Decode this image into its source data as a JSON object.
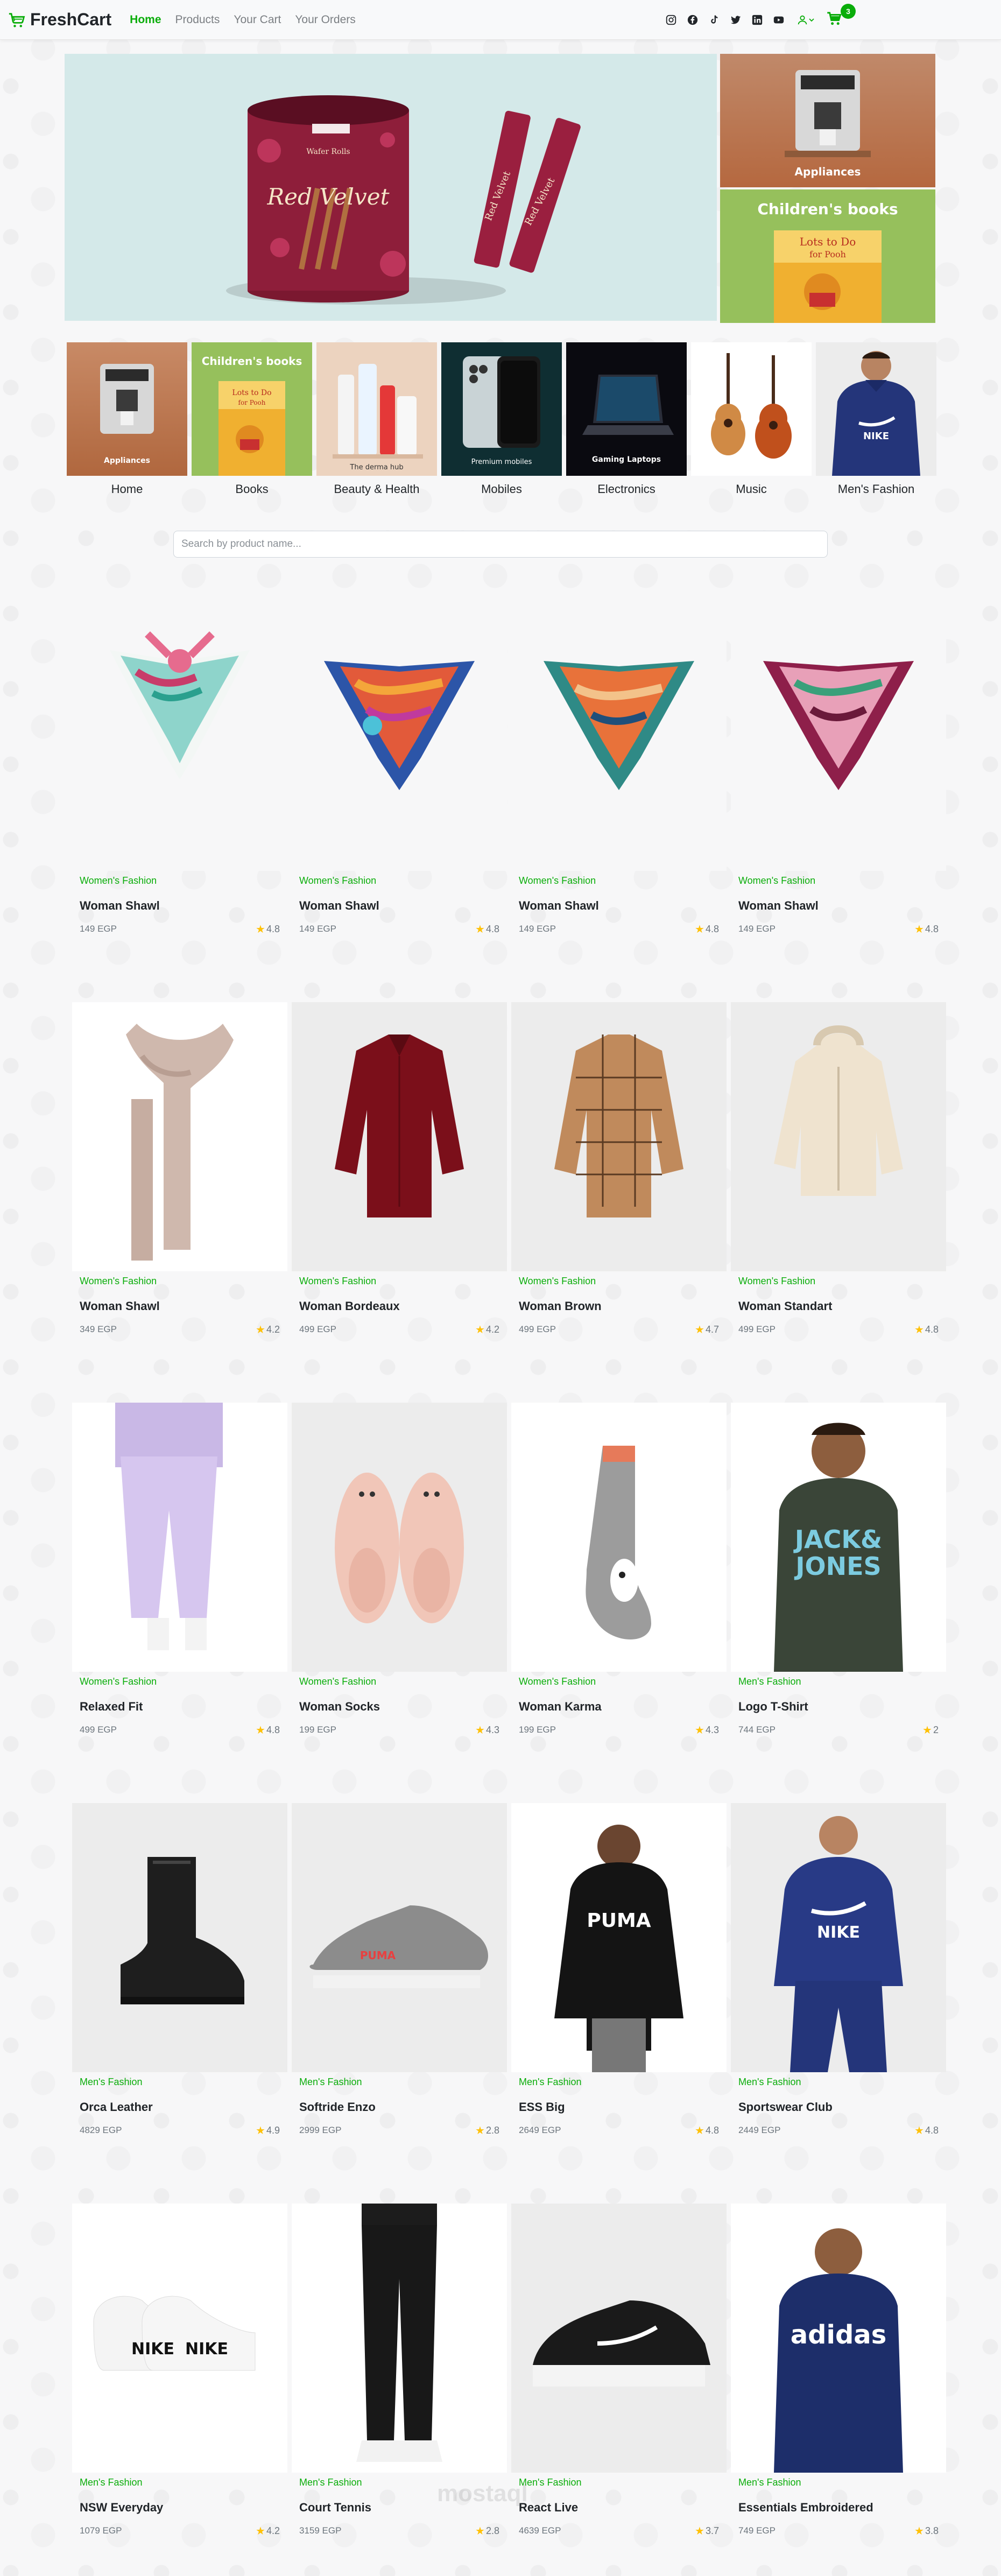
{
  "nav": {
    "brand": "FreshCart",
    "links": [
      "Home",
      "Products",
      "Your Cart",
      "Your Orders"
    ],
    "social_icons": [
      "instagram-icon",
      "facebook-icon",
      "tiktok-icon",
      "twitter-icon",
      "linkedin-icon",
      "youtube-icon"
    ],
    "cart_count": "3"
  },
  "hero": {
    "main_product": "Red Velvet",
    "main_sub": "Wafer Rolls",
    "side_top_label": "Appliances",
    "side_bottom_label": "Children's books"
  },
  "categories": [
    {
      "label": "Home",
      "caption": "Appliances"
    },
    {
      "label": "Books",
      "caption": "Children's books"
    },
    {
      "label": "Beauty & Health",
      "caption": "The derma hub"
    },
    {
      "label": "Mobiles",
      "caption": "Premium mobiles"
    },
    {
      "label": "Electronics",
      "caption": "Gaming Laptops"
    },
    {
      "label": "Music",
      "caption": ""
    },
    {
      "label": "Men's Fashion",
      "caption": ""
    }
  ],
  "search": {
    "placeholder": "Search by product name..."
  },
  "products": [
    {
      "category": "Women's Fashion",
      "title": "Woman Shawl",
      "price": "149 EGP",
      "rating": "4.8"
    },
    {
      "category": "Women's Fashion",
      "title": "Woman Shawl",
      "price": "149 EGP",
      "rating": "4.8"
    },
    {
      "category": "Women's Fashion",
      "title": "Woman Shawl",
      "price": "149 EGP",
      "rating": "4.8"
    },
    {
      "category": "Women's Fashion",
      "title": "Woman Shawl",
      "price": "149 EGP",
      "rating": "4.8"
    },
    {
      "category": "Women's Fashion",
      "title": "Woman Shawl",
      "price": "349 EGP",
      "rating": "4.2"
    },
    {
      "category": "Women's Fashion",
      "title": "Woman Bordeaux",
      "price": "499 EGP",
      "rating": "4.2"
    },
    {
      "category": "Women's Fashion",
      "title": "Woman Brown",
      "price": "499 EGP",
      "rating": "4.7"
    },
    {
      "category": "Women's Fashion",
      "title": "Woman Standart",
      "price": "499 EGP",
      "rating": "4.8"
    },
    {
      "category": "Women's Fashion",
      "title": "Relaxed Fit",
      "price": "499 EGP",
      "rating": "4.8"
    },
    {
      "category": "Women's Fashion",
      "title": "Woman Socks",
      "price": "199 EGP",
      "rating": "4.3"
    },
    {
      "category": "Women's Fashion",
      "title": "Woman Karma",
      "price": "199 EGP",
      "rating": "4.3"
    },
    {
      "category": "Men's Fashion",
      "title": "Logo T-Shirt",
      "price": "744 EGP",
      "rating": "2"
    },
    {
      "category": "Men's Fashion",
      "title": "Orca Leather",
      "price": "4829 EGP",
      "rating": "4.9"
    },
    {
      "category": "Men's Fashion",
      "title": "Softride Enzo",
      "price": "2999 EGP",
      "rating": "2.8"
    },
    {
      "category": "Men's Fashion",
      "title": "ESS Big",
      "price": "2649 EGP",
      "rating": "4.8"
    },
    {
      "category": "Men's Fashion",
      "title": "Sportswear Club",
      "price": "2449 EGP",
      "rating": "4.8"
    },
    {
      "category": "Men's Fashion",
      "title": "NSW Everyday",
      "price": "1079 EGP",
      "rating": "4.2"
    },
    {
      "category": "Men's Fashion",
      "title": "Court Tennis",
      "price": "3159 EGP",
      "rating": "2.8"
    },
    {
      "category": "Men's Fashion",
      "title": "React Live",
      "price": "4639 EGP",
      "rating": "3.7"
    },
    {
      "category": "Men's Fashion",
      "title": "Essentials Embroidered",
      "price": "749 EGP",
      "rating": "3.8"
    }
  ],
  "watermark": "mostaql"
}
